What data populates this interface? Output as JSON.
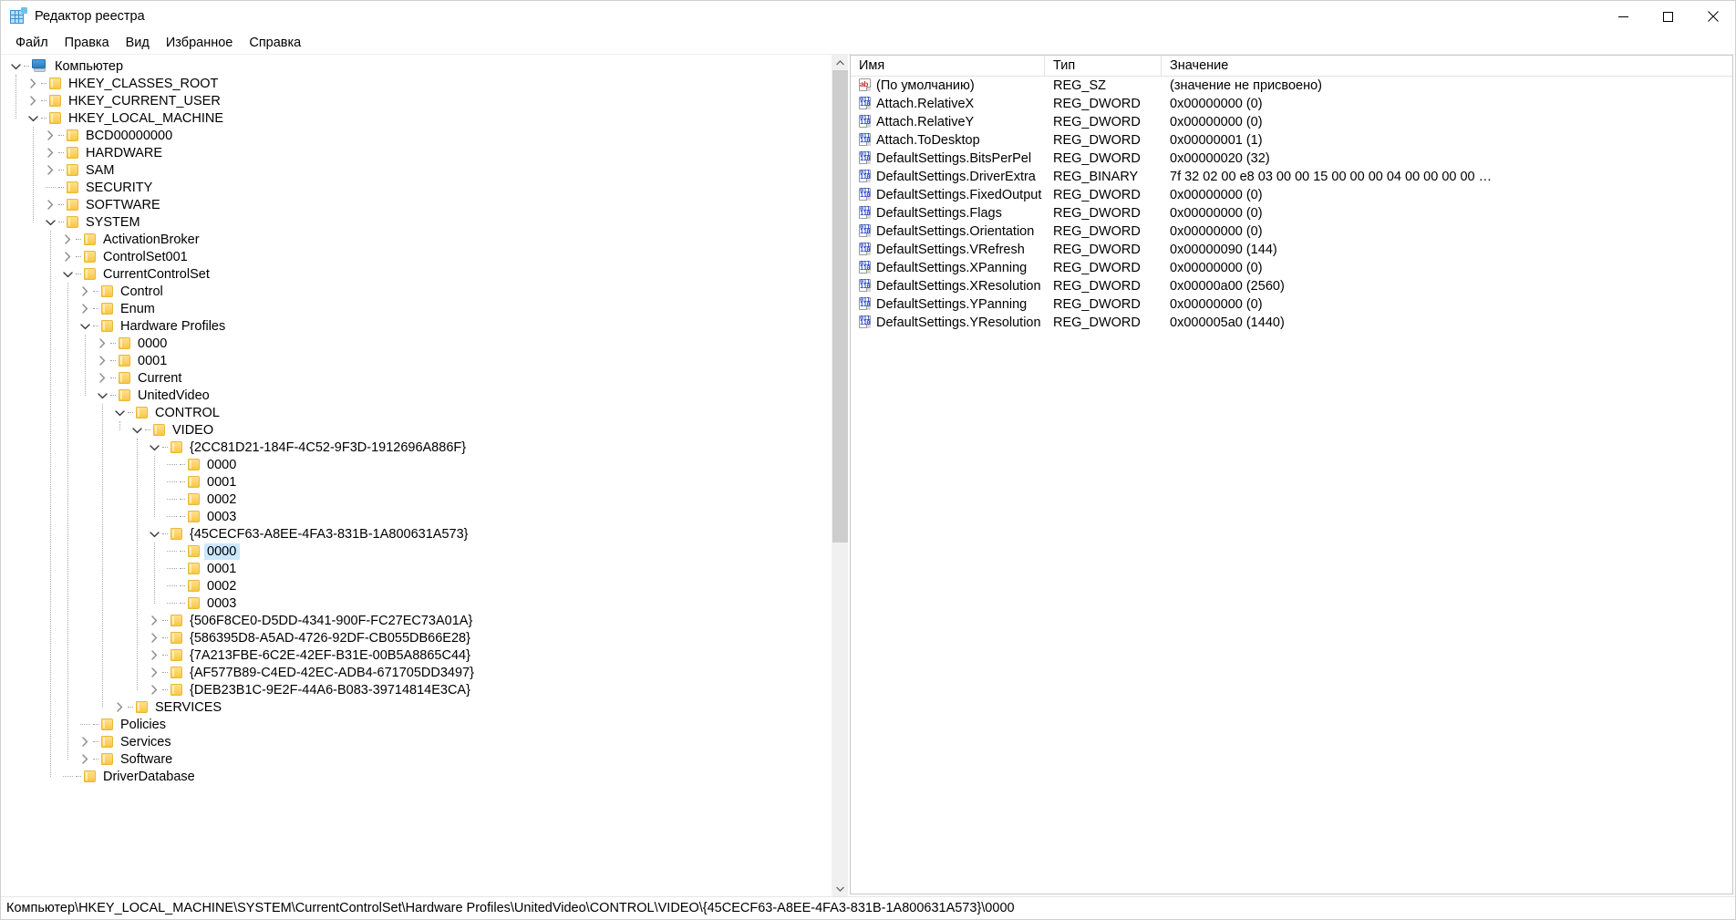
{
  "window": {
    "title": "Редактор реестра",
    "icon": "registry-icon",
    "minimize_label": "–",
    "maximize_label": "□",
    "close_label": "✕"
  },
  "menu": {
    "items": [
      {
        "label": "Файл",
        "name": "menu-file"
      },
      {
        "label": "Правка",
        "name": "menu-edit"
      },
      {
        "label": "Вид",
        "name": "menu-view"
      },
      {
        "label": "Избранное",
        "name": "menu-favorites"
      },
      {
        "label": "Справка",
        "name": "menu-help"
      }
    ]
  },
  "tree": {
    "nodes": [
      {
        "label": "Компьютер",
        "depth": 0,
        "state": "expanded",
        "icon": "computer-icon",
        "selected": false
      },
      {
        "label": "HKEY_CLASSES_ROOT",
        "depth": 1,
        "state": "collapsed",
        "icon": "folder-icon",
        "selected": false
      },
      {
        "label": "HKEY_CURRENT_USER",
        "depth": 1,
        "state": "collapsed",
        "icon": "folder-icon",
        "selected": false
      },
      {
        "label": "HKEY_LOCAL_MACHINE",
        "depth": 1,
        "state": "expanded",
        "icon": "folder-icon",
        "selected": false
      },
      {
        "label": "BCD00000000",
        "depth": 2,
        "state": "collapsed",
        "icon": "folder-icon",
        "selected": false
      },
      {
        "label": "HARDWARE",
        "depth": 2,
        "state": "collapsed",
        "icon": "folder-icon",
        "selected": false
      },
      {
        "label": "SAM",
        "depth": 2,
        "state": "collapsed",
        "icon": "folder-icon",
        "selected": false
      },
      {
        "label": "SECURITY",
        "depth": 2,
        "state": "leaf",
        "icon": "folder-icon",
        "selected": false
      },
      {
        "label": "SOFTWARE",
        "depth": 2,
        "state": "collapsed",
        "icon": "folder-icon",
        "selected": false
      },
      {
        "label": "SYSTEM",
        "depth": 2,
        "state": "expanded",
        "icon": "folder-icon",
        "selected": false
      },
      {
        "label": "ActivationBroker",
        "depth": 3,
        "state": "collapsed",
        "icon": "folder-icon",
        "selected": false
      },
      {
        "label": "ControlSet001",
        "depth": 3,
        "state": "collapsed",
        "icon": "folder-icon",
        "selected": false
      },
      {
        "label": "CurrentControlSet",
        "depth": 3,
        "state": "expanded",
        "icon": "folder-icon",
        "selected": false
      },
      {
        "label": "Control",
        "depth": 4,
        "state": "collapsed",
        "icon": "folder-icon",
        "selected": false
      },
      {
        "label": "Enum",
        "depth": 4,
        "state": "collapsed",
        "icon": "folder-icon",
        "selected": false
      },
      {
        "label": "Hardware Profiles",
        "depth": 4,
        "state": "expanded",
        "icon": "folder-icon",
        "selected": false
      },
      {
        "label": "0000",
        "depth": 5,
        "state": "collapsed",
        "icon": "folder-icon",
        "selected": false
      },
      {
        "label": "0001",
        "depth": 5,
        "state": "collapsed",
        "icon": "folder-icon",
        "selected": false
      },
      {
        "label": "Current",
        "depth": 5,
        "state": "collapsed",
        "icon": "folder-icon",
        "selected": false
      },
      {
        "label": "UnitedVideo",
        "depth": 5,
        "state": "expanded",
        "icon": "folder-icon",
        "selected": false
      },
      {
        "label": "CONTROL",
        "depth": 6,
        "state": "expanded",
        "icon": "folder-icon",
        "selected": false
      },
      {
        "label": "VIDEO",
        "depth": 7,
        "state": "expanded",
        "icon": "folder-icon",
        "selected": false
      },
      {
        "label": "{2CC81D21-184F-4C52-9F3D-1912696A886F}",
        "depth": 8,
        "state": "expanded",
        "icon": "folder-icon",
        "selected": false
      },
      {
        "label": "0000",
        "depth": 9,
        "state": "leaf",
        "icon": "folder-icon",
        "selected": false
      },
      {
        "label": "0001",
        "depth": 9,
        "state": "leaf",
        "icon": "folder-icon",
        "selected": false
      },
      {
        "label": "0002",
        "depth": 9,
        "state": "leaf",
        "icon": "folder-icon",
        "selected": false
      },
      {
        "label": "0003",
        "depth": 9,
        "state": "leaf",
        "icon": "folder-icon",
        "selected": false
      },
      {
        "label": "{45CECF63-A8EE-4FA3-831B-1A800631A573}",
        "depth": 8,
        "state": "expanded",
        "icon": "folder-icon",
        "selected": false
      },
      {
        "label": "0000",
        "depth": 9,
        "state": "leaf",
        "icon": "folder-icon",
        "selected": true
      },
      {
        "label": "0001",
        "depth": 9,
        "state": "leaf",
        "icon": "folder-icon",
        "selected": false
      },
      {
        "label": "0002",
        "depth": 9,
        "state": "leaf",
        "icon": "folder-icon",
        "selected": false
      },
      {
        "label": "0003",
        "depth": 9,
        "state": "leaf",
        "icon": "folder-icon",
        "selected": false
      },
      {
        "label": "{506F8CE0-D5DD-4341-900F-FC27EC73A01A}",
        "depth": 8,
        "state": "collapsed",
        "icon": "folder-icon",
        "selected": false
      },
      {
        "label": "{586395D8-A5AD-4726-92DF-CB055DB66E28}",
        "depth": 8,
        "state": "collapsed",
        "icon": "folder-icon",
        "selected": false
      },
      {
        "label": "{7A213FBE-6C2E-42EF-B31E-00B5A8865C44}",
        "depth": 8,
        "state": "collapsed",
        "icon": "folder-icon",
        "selected": false
      },
      {
        "label": "{AF577B89-C4ED-42EC-ADB4-671705DD3497}",
        "depth": 8,
        "state": "collapsed",
        "icon": "folder-icon",
        "selected": false
      },
      {
        "label": "{DEB23B1C-9E2F-44A6-B083-39714814E3CA}",
        "depth": 8,
        "state": "collapsed",
        "icon": "folder-icon",
        "selected": false
      },
      {
        "label": "SERVICES",
        "depth": 6,
        "state": "collapsed",
        "icon": "folder-icon",
        "selected": false
      },
      {
        "label": "Policies",
        "depth": 4,
        "state": "leaf",
        "icon": "folder-icon",
        "selected": false
      },
      {
        "label": "Services",
        "depth": 4,
        "state": "collapsed",
        "icon": "folder-icon",
        "selected": false
      },
      {
        "label": "Software",
        "depth": 4,
        "state": "collapsed",
        "icon": "folder-icon",
        "selected": false
      },
      {
        "label": "DriverDatabase",
        "depth": 3,
        "state": "leaf",
        "icon": "folder-icon",
        "selected": false
      }
    ]
  },
  "list": {
    "columns": [
      {
        "label": "Имя",
        "name": "column-name"
      },
      {
        "label": "Тип",
        "name": "column-type"
      },
      {
        "label": "Значение",
        "name": "column-value"
      }
    ],
    "rows": [
      {
        "name": "(По умолчанию)",
        "type": "REG_SZ",
        "value": "(значение не присвоено)",
        "icon": "string-value-icon"
      },
      {
        "name": "Attach.RelativeX",
        "type": "REG_DWORD",
        "value": "0x00000000 (0)",
        "icon": "binary-value-icon"
      },
      {
        "name": "Attach.RelativeY",
        "type": "REG_DWORD",
        "value": "0x00000000 (0)",
        "icon": "binary-value-icon"
      },
      {
        "name": "Attach.ToDesktop",
        "type": "REG_DWORD",
        "value": "0x00000001 (1)",
        "icon": "binary-value-icon"
      },
      {
        "name": "DefaultSettings.BitsPerPel",
        "type": "REG_DWORD",
        "value": "0x00000020 (32)",
        "icon": "binary-value-icon"
      },
      {
        "name": "DefaultSettings.DriverExtra",
        "type": "REG_BINARY",
        "value": "7f 32 02 00 e8 03 00 00 15 00 00 00 04 00 00 00 00 …",
        "icon": "binary-value-icon"
      },
      {
        "name": "DefaultSettings.FixedOutput",
        "type": "REG_DWORD",
        "value": "0x00000000 (0)",
        "icon": "binary-value-icon"
      },
      {
        "name": "DefaultSettings.Flags",
        "type": "REG_DWORD",
        "value": "0x00000000 (0)",
        "icon": "binary-value-icon"
      },
      {
        "name": "DefaultSettings.Orientation",
        "type": "REG_DWORD",
        "value": "0x00000000 (0)",
        "icon": "binary-value-icon"
      },
      {
        "name": "DefaultSettings.VRefresh",
        "type": "REG_DWORD",
        "value": "0x00000090 (144)",
        "icon": "binary-value-icon"
      },
      {
        "name": "DefaultSettings.XPanning",
        "type": "REG_DWORD",
        "value": "0x00000000 (0)",
        "icon": "binary-value-icon"
      },
      {
        "name": "DefaultSettings.XResolution",
        "type": "REG_DWORD",
        "value": "0x00000a00 (2560)",
        "icon": "binary-value-icon"
      },
      {
        "name": "DefaultSettings.YPanning",
        "type": "REG_DWORD",
        "value": "0x00000000 (0)",
        "icon": "binary-value-icon"
      },
      {
        "name": "DefaultSettings.YResolution",
        "type": "REG_DWORD",
        "value": "0x000005a0 (1440)",
        "icon": "binary-value-icon"
      }
    ]
  },
  "statusbar": {
    "path": "Компьютер\\HKEY_LOCAL_MACHINE\\SYSTEM\\CurrentControlSet\\Hardware Profiles\\UnitedVideo\\CONTROL\\VIDEO\\{45CECF63-A8EE-4FA3-831B-1A800631A573}\\0000"
  },
  "colors": {
    "selection": "#cce8ff",
    "folder": "#fcd368",
    "accent": "#3a8fd4"
  }
}
